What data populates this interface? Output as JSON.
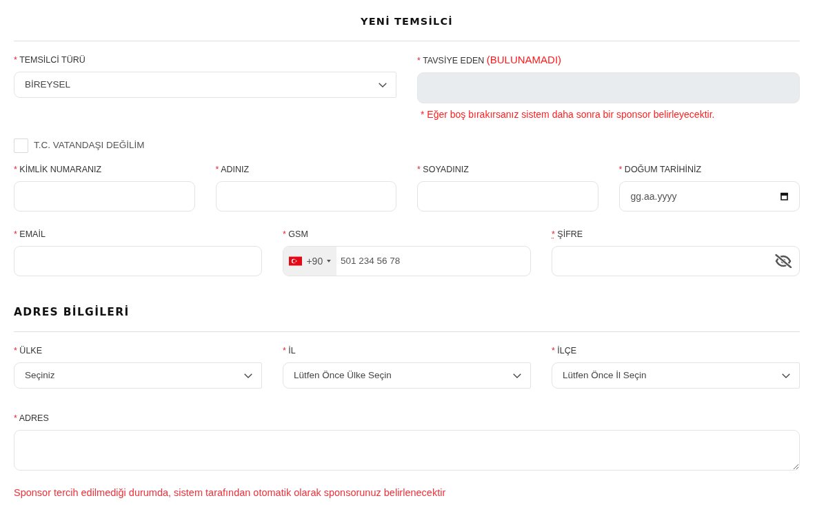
{
  "title": "YENİ TEMSİLCİ",
  "top_row": [
    {
      "kind": "select",
      "mark": "*",
      "label": "TEMSİLCİ TÜRÜ",
      "value": "BİREYSEL"
    },
    {
      "kind": "readonly",
      "mark": "*",
      "label": "TAVSİYE EDEN",
      "status": "(BULUNAMADI)",
      "hint": "* Eğer boş bırakırsanız sistem daha sonra bir sponsor belirleyecektir."
    }
  ],
  "citizenship_checkbox": {
    "label": "T.C. VATANDAŞI DEĞİLİM",
    "checked": false
  },
  "identity_row": [
    {
      "kind": "text",
      "mark": "*",
      "label": "KİMLİK NUMARANIZ"
    },
    {
      "kind": "text",
      "mark": "*",
      "label": "ADINIZ"
    },
    {
      "kind": "text",
      "mark": "*",
      "label": "SOYADINIZ"
    },
    {
      "kind": "date",
      "mark": "*",
      "label": "DOĞUM TARİHİNİZ",
      "placeholder": "gg.aa.yyyy"
    }
  ],
  "contact_row": [
    {
      "kind": "text",
      "mark": "*",
      "mark_dotted": false,
      "label": "EMAİL"
    },
    {
      "kind": "phone",
      "mark": "*",
      "mark_dotted": false,
      "label": "GSM",
      "dial_code": "+90",
      "placeholder": "501 234 56 78"
    },
    {
      "kind": "password",
      "mark": "*",
      "mark_dotted": true,
      "label": "ŞİFRE"
    }
  ],
  "address_section": {
    "title": "ADRES BİLGİLERİ",
    "location_row": [
      {
        "kind": "select",
        "mark": "*",
        "label": "ÜLKE",
        "value": "Seçiniz"
      },
      {
        "kind": "select",
        "mark": "*",
        "label": "İL",
        "value": "Lütfen Önce Ülke Seçin"
      },
      {
        "kind": "select",
        "mark": "*",
        "label": "İLÇE",
        "value": "Lütfen Önce İl Seçin"
      }
    ],
    "address_row": [
      {
        "kind": "textarea",
        "mark": "*",
        "label": "ADRES"
      }
    ],
    "note": "Sponsor tercih edilmediği durumda, sistem tarafından otomatik olarak sponsorunuz belirlenecektir"
  }
}
